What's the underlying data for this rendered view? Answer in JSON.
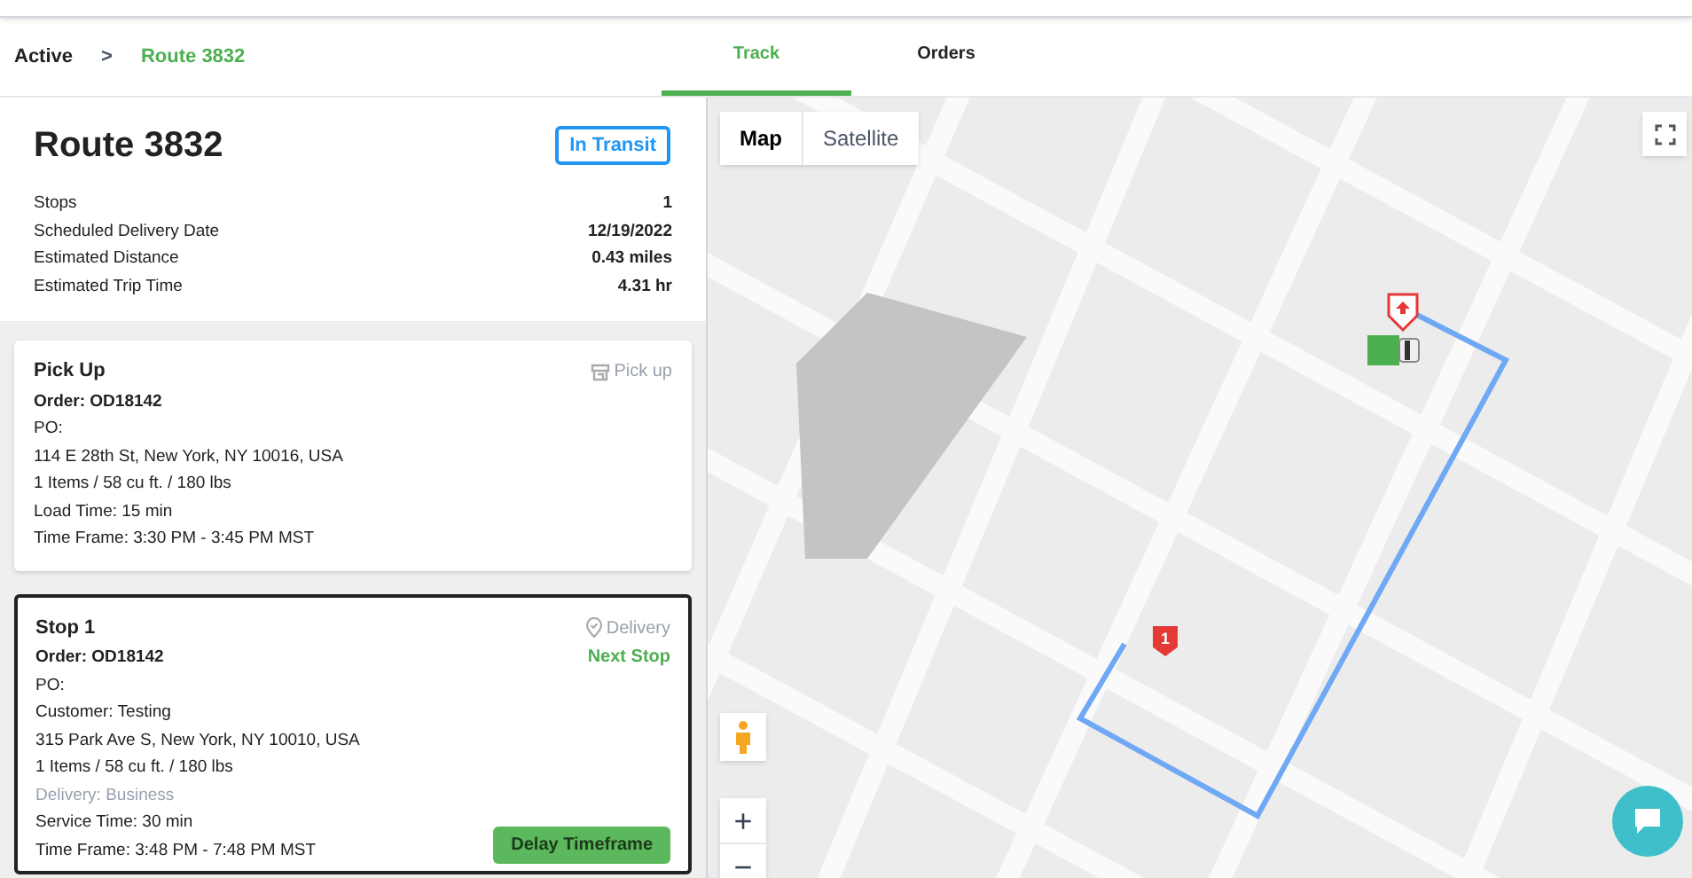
{
  "breadcrumb": {
    "parent": "Active",
    "separator": ">",
    "current": "Route 3832"
  },
  "tabs": [
    {
      "label": "Track",
      "selected": true
    },
    {
      "label": "Orders",
      "selected": false
    }
  ],
  "route": {
    "title": "Route 3832",
    "status": "In Transit",
    "details": [
      {
        "label": "Stops",
        "value": "1"
      },
      {
        "label": "Scheduled Delivery Date",
        "value": "12/19/2022"
      },
      {
        "label": "Estimated Distance",
        "value": "0.43 miles"
      },
      {
        "label": "Estimated Trip Time",
        "value": "4.31 hr"
      }
    ]
  },
  "stops": [
    {
      "kind": "pickup",
      "selected": false,
      "title": "Pick Up",
      "type_label": "Pick up",
      "order_label": "Order:",
      "order": "OD18142",
      "lines": [
        {
          "text": "PO:",
          "muted": false
        },
        {
          "text": "114 E 28th St, New York, NY 10016, USA",
          "muted": false
        },
        {
          "text": "1 Items / 58 cu ft. / 180 lbs",
          "muted": false
        },
        {
          "text": "Load Time: 15 min",
          "muted": false
        },
        {
          "text": "Time Frame: 3:30 PM - 3:45 PM MST",
          "muted": false
        }
      ]
    },
    {
      "kind": "delivery",
      "selected": true,
      "title": "Stop 1",
      "type_label": "Delivery",
      "badge": "Next Stop",
      "order_label": "Order:",
      "order": "OD18142",
      "lines": [
        {
          "text": "PO:",
          "muted": false
        },
        {
          "text": "Customer: Testing",
          "muted": false
        },
        {
          "text": "315 Park Ave S, New York, NY 10010, USA",
          "muted": false
        },
        {
          "text": "1 Items / 58 cu ft. / 180 lbs",
          "muted": false
        },
        {
          "text": "Delivery: Business",
          "muted": true
        },
        {
          "text": "Service Time: 30 min",
          "muted": false
        },
        {
          "text": "Time Frame: 3:48 PM - 7:48 PM MST",
          "muted": false
        }
      ],
      "button": "Delay Timeframe"
    }
  ],
  "map": {
    "map_types": [
      {
        "label": "Map",
        "selected": true
      },
      {
        "label": "Satellite",
        "selected": false
      }
    ],
    "stop_marker": "1",
    "zoom_in": "+",
    "zoom_out": "−"
  }
}
